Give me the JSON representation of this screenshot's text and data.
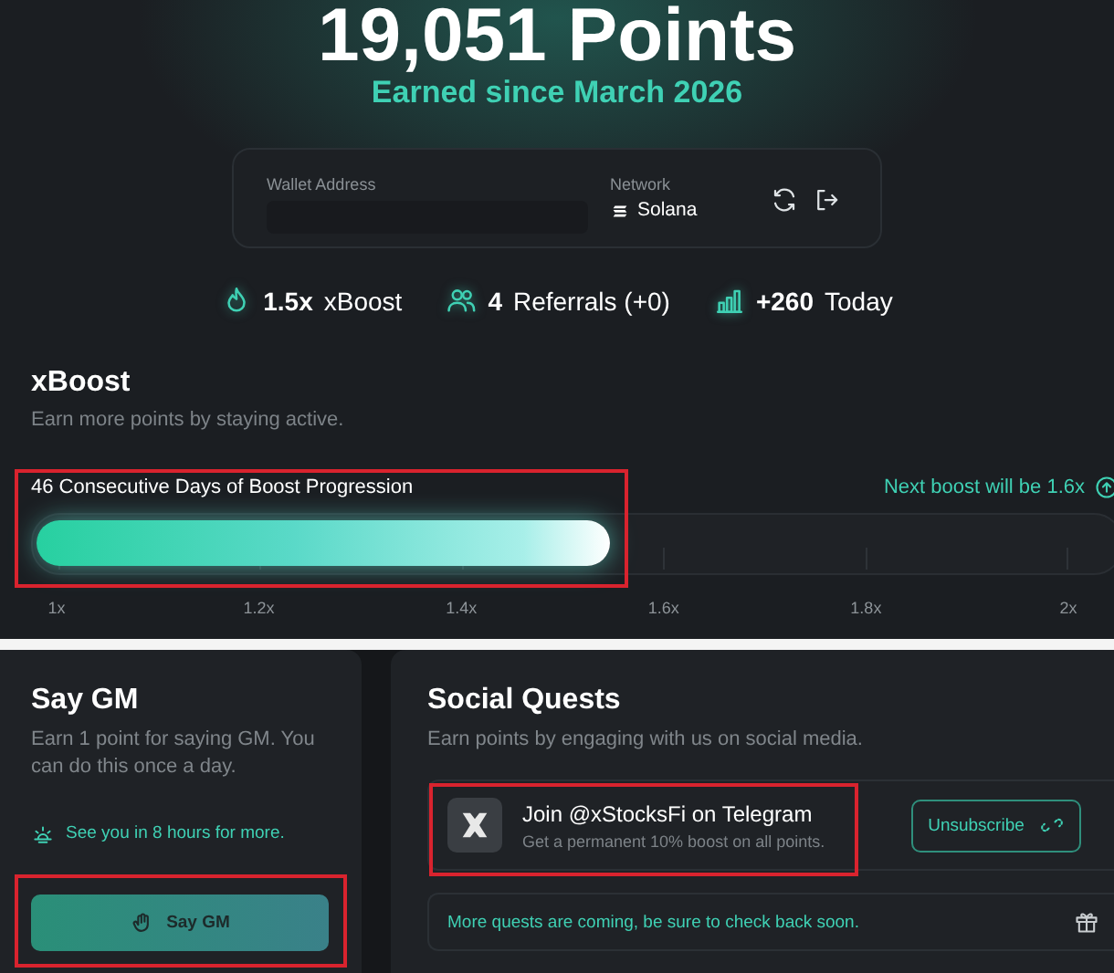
{
  "hero": {
    "points": "19,051 Points",
    "subtitle": "Earned since March 2026"
  },
  "wallet": {
    "address_label": "Wallet Address",
    "network_label": "Network",
    "network": "Solana"
  },
  "stats": [
    {
      "kind": "boost",
      "value": "1.5x",
      "label": "xBoost"
    },
    {
      "kind": "referrals",
      "value": "4",
      "label": "Referrals (+0)"
    },
    {
      "kind": "today",
      "value": "+260",
      "label": "Today"
    }
  ],
  "xboost": {
    "title": "xBoost",
    "subtitle": "Earn more points by staying active.",
    "progress_label": "46 Consecutive Days of Boost Progression",
    "next_boost": "Next boost will be 1.6x",
    "level": 0.53,
    "ticks": [
      "1x",
      "1.2x",
      "1.4x",
      "1.6x",
      "1.8x",
      "2x"
    ]
  },
  "say_gm": {
    "title": "Say GM",
    "description": "Earn 1 point for saying GM. You can do this once a day.",
    "cooldown": "See you in 8 hours for more.",
    "button": "Say GM"
  },
  "social_quests": {
    "title": "Social Quests",
    "description": "Earn points by engaging with us on social media.",
    "quests": [
      {
        "title": "Join @xStocksFi on Telegram",
        "description": "Get a permanent 10% boost on all points.",
        "button": "Unsubscribe"
      }
    ],
    "notice": "More quests are coming, be sure to check back soon."
  }
}
